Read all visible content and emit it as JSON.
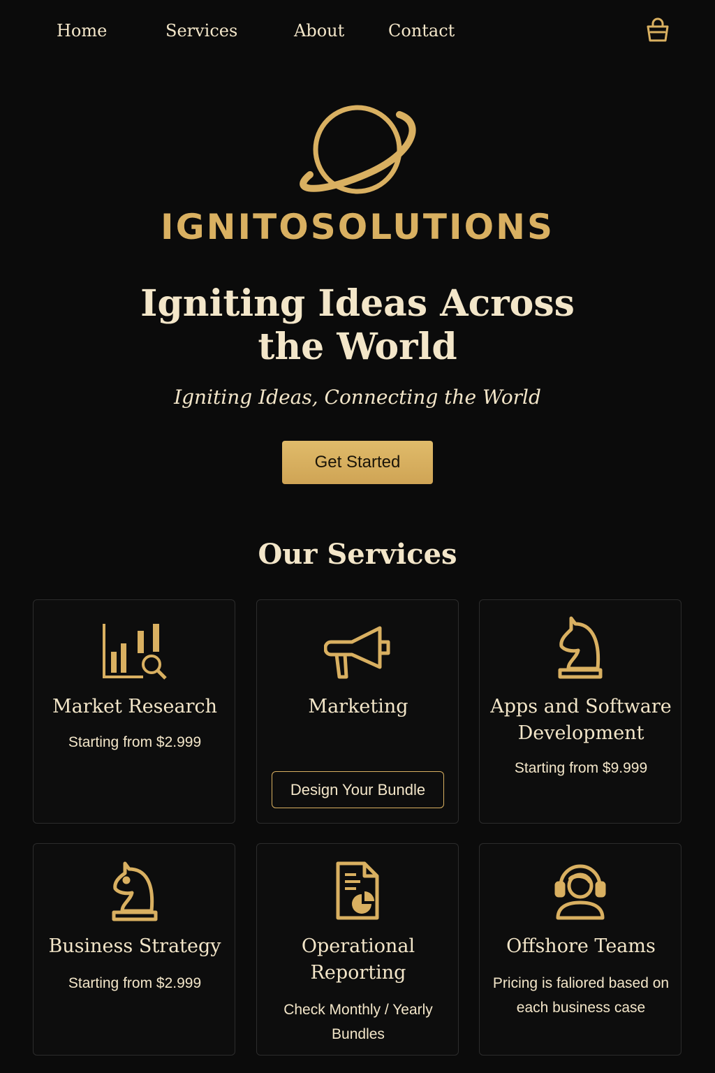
{
  "nav": {
    "items": [
      "Home",
      "Services",
      "About",
      "Contact"
    ],
    "cart_icon": "shopping-bag-icon"
  },
  "hero": {
    "logo_icon": "planet-ring-icon",
    "brand": "IGNITOSOLUTIONS",
    "title": "Igniting Ideas Across the World",
    "subtitle": "Igniting Ideas, Connecting the World",
    "cta": "Get Started"
  },
  "services": {
    "title": "Our Services",
    "cards": [
      {
        "title": "Market Research",
        "price": "Starting from $2.999",
        "icon": "bar-chart-magnifier-icon"
      },
      {
        "title": "Marketing",
        "button": "Design Your Bundle",
        "icon": "megaphone-icon"
      },
      {
        "title": "Apps and Software Development",
        "price": "Starting from $9.999",
        "icon": "chess-knight-icon"
      },
      {
        "title": "Business Strategy",
        "price": "Starting from $2.999",
        "icon": "chess-knight-icon"
      },
      {
        "title": "Operational Reporting",
        "price": "Check Monthly / Yearly Bundles",
        "icon": "report-document-icon"
      },
      {
        "title": "Offshore Teams",
        "price": "Pricing is faliored based on each business case",
        "icon": "headset-agent-icon"
      }
    ]
  },
  "colors": {
    "background": "#0b0b0b",
    "gold": "#d9b061",
    "text": "#f3e6c9"
  }
}
